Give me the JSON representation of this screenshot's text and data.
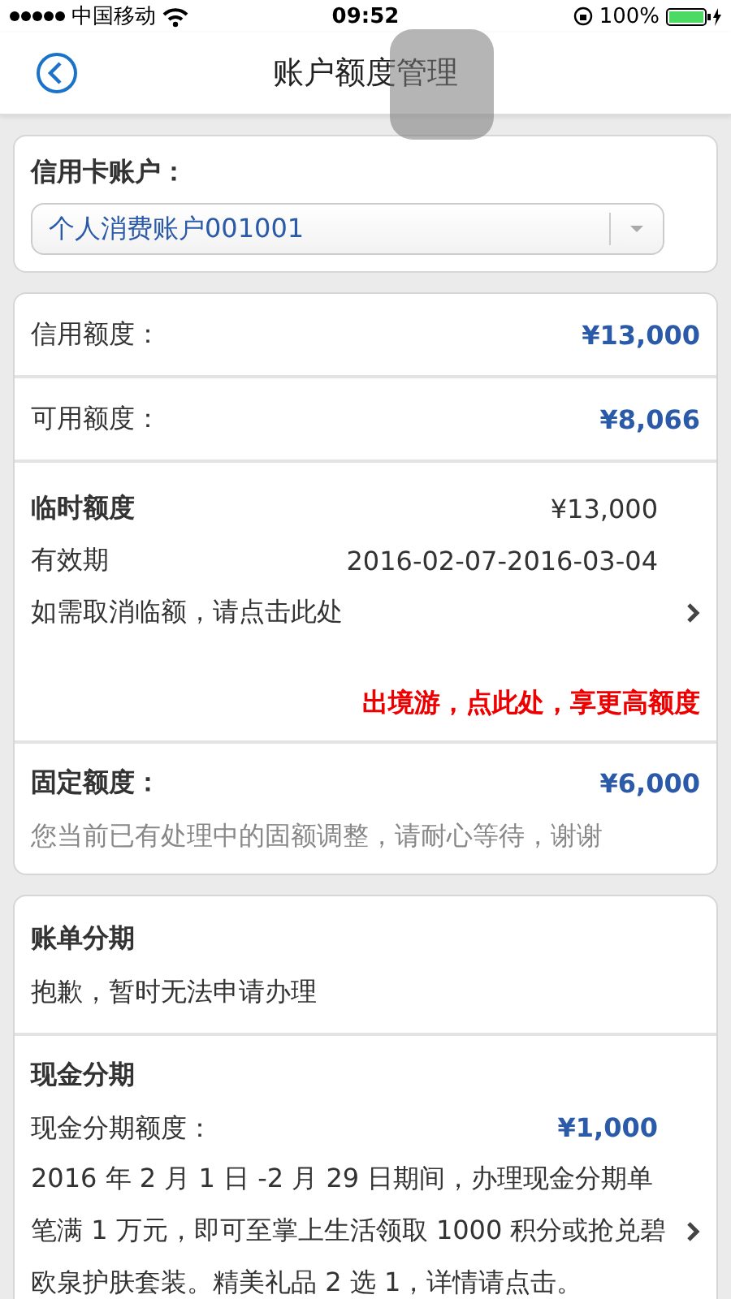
{
  "status_bar": {
    "carrier": "中国移动",
    "time": "09:52",
    "battery": "100%"
  },
  "nav": {
    "title": "账户额度管理"
  },
  "account": {
    "label": "信用卡账户：",
    "value": "个人消费账户001001"
  },
  "limits": [
    {
      "kind": "amount",
      "label": "信用额度：",
      "value": "¥13,000"
    },
    {
      "kind": "amount",
      "label": "可用额度：",
      "value": "¥8,066"
    },
    {
      "kind": "temporary",
      "title": "临时额度",
      "value": "¥13,000",
      "validity_label": "有效期",
      "validity": "2016-02-07-2016-03-04",
      "link": "如需取消临额，请点击此处",
      "promo": "出境游，点此处，享更高额度"
    },
    {
      "kind": "fixed",
      "label": "固定额度：",
      "value": "¥6,000",
      "note": "您当前已有处理中的固额调整，请耐心等待，谢谢"
    }
  ],
  "installments": [
    {
      "kind": "notice",
      "title": "账单分期",
      "note": "抱歉，暂时无法申请办理"
    },
    {
      "kind": "offer",
      "title": "现金分期",
      "limit_label": "现金分期额度：",
      "limit_value": "¥1,000",
      "description": "2016 年 2 月 1 日 -2 月 29 日期间，办理现金分期单笔满 1 万元，即可至掌上生活领取 1000 积分或抢兑碧欧泉护肤套装。精美礼品 2 选 1，详情请点击。"
    }
  ]
}
